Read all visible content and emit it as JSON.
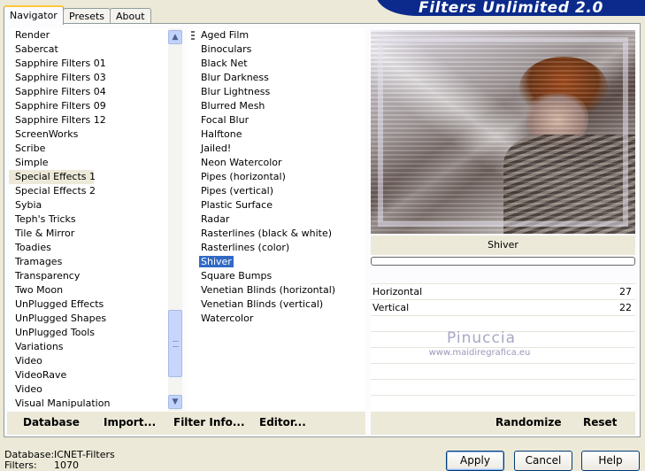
{
  "app": {
    "title": "Filters Unlimited 2.0"
  },
  "tabs": [
    {
      "label": "Navigator",
      "active": true
    },
    {
      "label": "Presets",
      "active": false
    },
    {
      "label": "About",
      "active": false
    }
  ],
  "categories": {
    "items": [
      "Render",
      "Sabercat",
      "Sapphire Filters 01",
      "Sapphire Filters 03",
      "Sapphire Filters 04",
      "Sapphire Filters 09",
      "Sapphire Filters 12",
      "ScreenWorks",
      "Scribe",
      "Simple",
      "Special Effects 1",
      "Special Effects 2",
      "Sybia",
      "Teph's Tricks",
      "Tile & Mirror",
      "Toadies",
      "Tramages",
      "Transparency",
      "Two Moon",
      "UnPlugged Effects",
      "UnPlugged Shapes",
      "UnPlugged Tools",
      "Variations",
      "Video",
      "VideoRave",
      "Video",
      "Visual Manipulation"
    ],
    "selected": "Special Effects 1"
  },
  "filters": {
    "items": [
      "Aged Film",
      "Binoculars",
      "Black Net",
      "Blur Darkness",
      "Blur Lightness",
      "Blurred Mesh",
      "Focal Blur",
      "Halftone",
      "Jailed!",
      "Neon Watercolor",
      "Pipes (horizontal)",
      "Pipes (vertical)",
      "Plastic Surface",
      "Radar",
      "Rasterlines (black & white)",
      "Rasterlines (color)",
      "Shiver",
      "Square Bumps",
      "Venetian Blinds (horizontal)",
      "Venetian Blinds (vertical)",
      "Watercolor"
    ],
    "selected": "Shiver"
  },
  "preview": {
    "filter_name": "Shiver",
    "progress": 0
  },
  "parameters": [
    {
      "label": "Horizontal",
      "value": "27"
    },
    {
      "label": "Vertical",
      "value": "22"
    }
  ],
  "watermark": {
    "name": "Pinuccia",
    "site": "www.maidiregrafica.eu"
  },
  "toolbar": {
    "database": "Database",
    "import": "Import...",
    "filter_info": "Filter Info...",
    "editor": "Editor...",
    "randomize": "Randomize",
    "reset": "Reset"
  },
  "status": {
    "database_label": "Database:",
    "database_value": "ICNET-Filters",
    "filters_label": "Filters:",
    "filters_value": "1070"
  },
  "buttons": {
    "apply": "Apply",
    "cancel": "Cancel",
    "help": "Help"
  },
  "colors": {
    "banner": "#0b2a8c",
    "selection": "#316ac5",
    "face": "#ece9d8"
  },
  "icons": {
    "scroll_up": "chevron-up-icon",
    "scroll_down": "chevron-down-icon"
  }
}
